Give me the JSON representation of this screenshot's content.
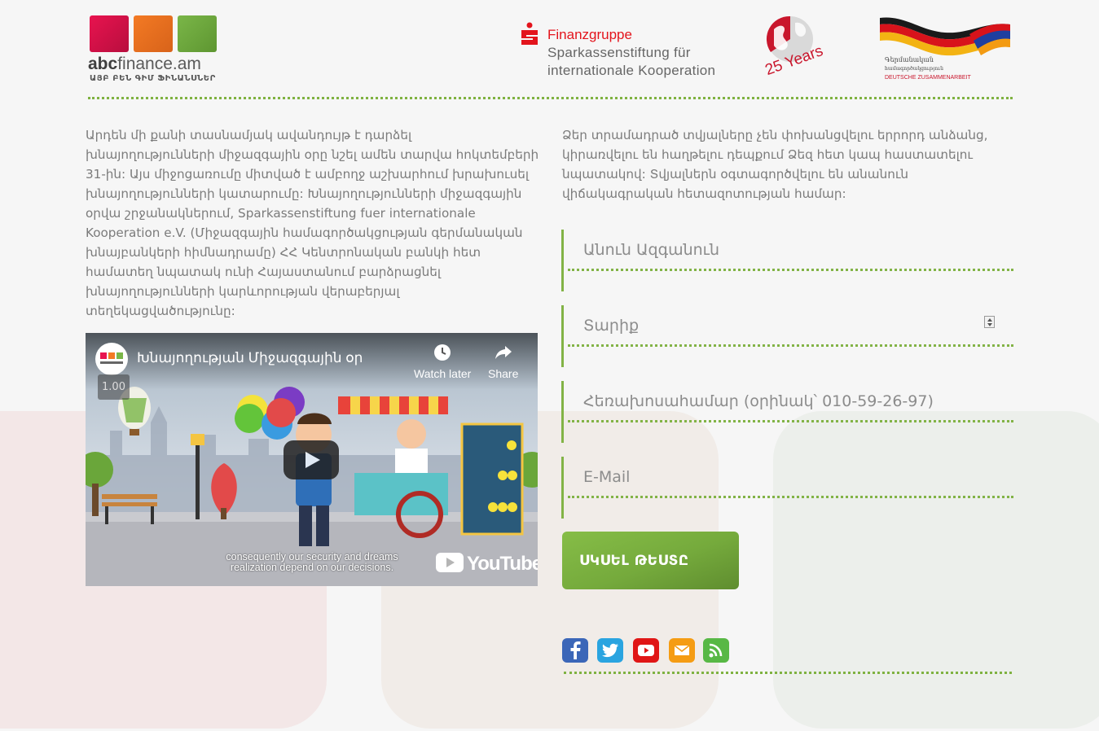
{
  "header": {
    "abc_brand_bold": "abc",
    "abc_brand_rest": "finance.am",
    "abc_tagline": "ԱՅԲ ԲԵՆ ԳԻՄ ՖԻՆԱՆՍՆԵՐ",
    "sparkasse_line1": "Finanzgruppe",
    "sparkasse_line2": "Sparkassenstiftung für",
    "sparkasse_line3": "internationale Kooperation",
    "anniversary": "25 Years",
    "giz_line1": "Գերմանական",
    "giz_line2": "համագործակցություն",
    "giz_line3": "DEUTSCHE ZUSAMMENARBEIT"
  },
  "intro_text": "Արդեն մի քանի տասնամյակ ավանդույթ է դարձել խնայողությունների միջազգային օրը նշել ամեն տարվա հոկտեմբերի 31-ին: Այս միջոցառումը միտված է ամբողջ աշխարհում խրախուսել խնայողությունների կատարումը: Խնայողությունների միջազգային օրվա շրջանակներում, Sparkassenstiftung fuer internationale Kooperation e.V. (Միջազգային համագործակցության գերմանական խնայբանկերի հիմնադրամը) ՀՀ Կենտրոնական բանկի հետ համատեղ նպատակ ունի Հայաստանում բարձրացնել խնայողությունների կարևորության վերաբերյալ տեղեկացվածությունը:",
  "video": {
    "title": "Խնայողության Միջազգային օր",
    "speed": "1.00",
    "watch_later": "Watch later",
    "share": "Share",
    "caption_line1": "consequently our security and dreams",
    "caption_line2": "realization depend on our decisions.",
    "youtube": "YouTube"
  },
  "privacy_text": "Ձեր տրամադրած տվյալները չեն փոխանցվելու երրորդ անձանց, կիրառվելու են հաղթելու դեպքում Ձեզ հետ կապ հաստատելու նպատակով: Տվյալներն օգտագործվելու են անանուն վիճակագրական հետազոտության համար:",
  "form": {
    "name_placeholder": "Անուն Ազգանուն",
    "age_placeholder": "Տարիք",
    "phone_placeholder": "Հեռախոսահամար (օրինակ՝ 010-59-26-97)",
    "email_placeholder": "E-Mail",
    "start_label": "ՍԿՍԵԼ ԹԵՍՏԸ"
  },
  "social": [
    "facebook-icon",
    "twitter-icon",
    "youtube-icon",
    "mail-icon",
    "rss-icon"
  ],
  "colors": {
    "accent_green": "#7ab648",
    "brand_red": "#e3141c",
    "text_gray": "#7b7b7b"
  }
}
